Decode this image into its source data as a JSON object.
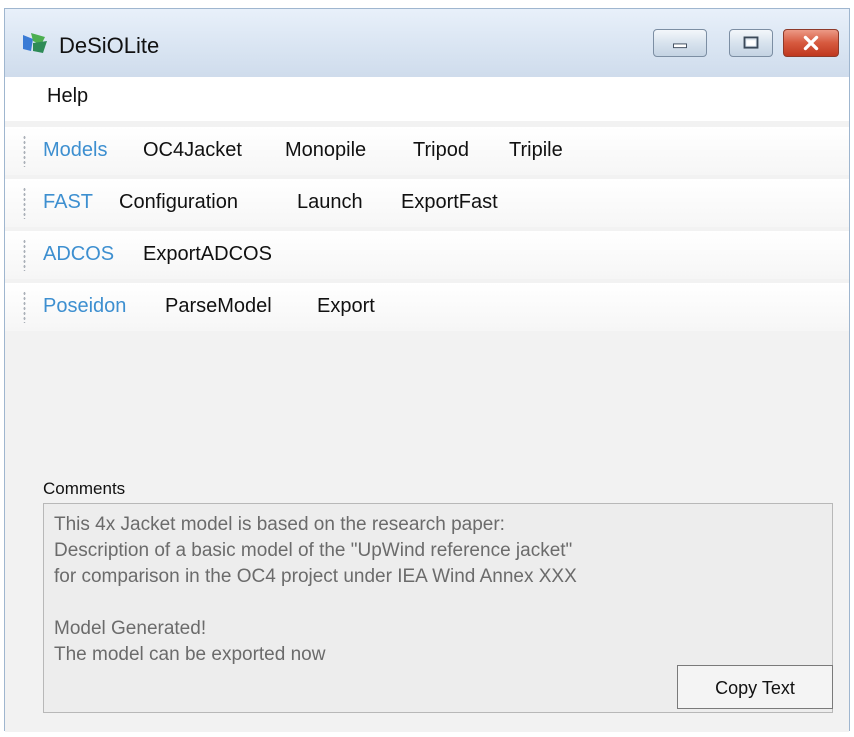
{
  "window": {
    "title": "DeSiOLite"
  },
  "menu": {
    "help_label": "Help"
  },
  "toolstrips": [
    {
      "label": "Models",
      "items": [
        "OC4Jacket",
        "Monopile",
        "Tripod",
        "Tripile"
      ]
    },
    {
      "label": "FAST",
      "items": [
        "Configuration",
        "Launch",
        "ExportFast"
      ]
    },
    {
      "label": "ADCOS",
      "items": [
        "ExportADCOS"
      ]
    },
    {
      "label": "Poseidon",
      "items": [
        "ParseModel",
        "Export"
      ]
    }
  ],
  "comments": {
    "label": "Comments",
    "lines": [
      "This 4x Jacket model is based on the research paper:",
      "Description of a basic model of the \"UpWind reference jacket\"",
      "for comparison in the OC4 project under IEA Wind Annex XXX",
      "",
      "Model Generated!",
      "The model can be exported now"
    ],
    "copy_button_label": "Copy Text"
  },
  "colors": {
    "toolstrip_label": "#3d8fd0",
    "close_button": "#d6593e"
  },
  "icons": {
    "app": "app-logo-icon",
    "minimize": "minimize-icon",
    "maximize": "maximize-icon",
    "close": "close-icon"
  }
}
